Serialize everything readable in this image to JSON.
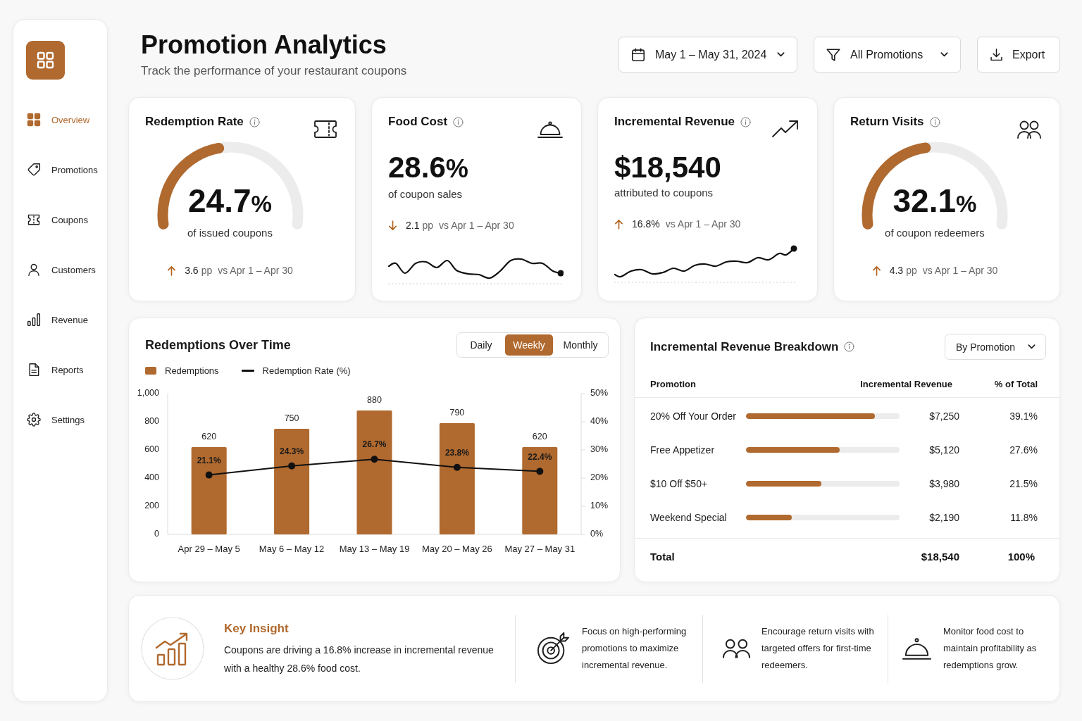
{
  "sidebar": {
    "items": [
      {
        "label": "Overview",
        "selected": true
      },
      {
        "label": "Promotions",
        "selected": false
      },
      {
        "label": "Coupons",
        "selected": false
      },
      {
        "label": "Customers",
        "selected": false
      },
      {
        "label": "Revenue",
        "selected": false
      },
      {
        "label": "Reports",
        "selected": false
      },
      {
        "label": "Settings",
        "selected": false
      }
    ]
  },
  "header": {
    "title": "Promotion Analytics",
    "subtitle": "Track the performance of your restaurant coupons"
  },
  "toolbar": {
    "date_range": "May 1 – May 31, 2024",
    "filter": "All Promotions",
    "export": "Export"
  },
  "kpis": [
    {
      "kind": "gauge",
      "title": "Redemption Rate",
      "value": "24.7",
      "unit": "%",
      "caption": "of issued coupons",
      "level": 0.45,
      "delta": {
        "rising": true,
        "value": "3.6",
        "unit": "pp",
        "comparison": "vs Apr 1 – Apr 30"
      }
    },
    {
      "kind": "sparkline",
      "title": "Food Cost",
      "value": "28.6",
      "unit": "%",
      "caption": "of coupon sales",
      "delta": {
        "rising": false,
        "value": "2.1",
        "unit": "pp",
        "comparison": "vs Apr 1 – Apr 30"
      }
    },
    {
      "kind": "sparkline",
      "title": "Incremental Revenue",
      "value": "$18,540",
      "caption": "attributed to coupons",
      "delta": {
        "rising": true,
        "value": "16.8%",
        "comparison": "vs Apr 1 – Apr 30"
      }
    },
    {
      "kind": "gauge",
      "title": "Return Visits",
      "value": "32.1",
      "unit": "%",
      "caption": "of coupon redeemers",
      "level": 0.46,
      "delta": {
        "rising": true,
        "value": "4.3",
        "unit": "pp",
        "comparison": "vs Apr 1 – Apr 30"
      }
    }
  ],
  "redemptions_chart": {
    "range_options": [
      {
        "label": "Daily",
        "selected": false
      },
      {
        "label": "Weekly",
        "selected": true
      },
      {
        "label": "Monthly",
        "selected": false
      }
    ],
    "chart_data": {
      "type": "bar",
      "title": "Redemptions Over Time",
      "legend": "top-left",
      "categories": [
        "Apr 29 – May 5",
        "May 6 – May 12",
        "May 13 – May 19",
        "May 20 – May 26",
        "May 27 – May 31"
      ],
      "series": [
        {
          "name": "Redemptions",
          "color": "#b0692e",
          "values": [
            620,
            750,
            880,
            790,
            620
          ],
          "value_labels": [
            "620",
            "750",
            "880",
            "790",
            "620"
          ]
        },
        {
          "name": "Redemption Rate (%)",
          "type": "line",
          "axis": "y2",
          "marker": true,
          "color": "#111111",
          "values": [
            21.1,
            24.3,
            26.7,
            23.8,
            22.4
          ],
          "value_labels": [
            "21.1%",
            "24.3%",
            "26.7%",
            "23.8%",
            "22.4%"
          ]
        }
      ],
      "ylim": [
        0,
        1000
      ],
      "yticks": [
        0,
        200,
        400,
        600,
        800,
        {
          "value": 1000,
          "label": "1,000"
        }
      ],
      "y2lim": [
        0,
        50
      ],
      "y2ticks": [
        {
          "value": 0,
          "label": "0%"
        },
        {
          "value": 10,
          "label": "10%"
        },
        {
          "value": 20,
          "label": "20%"
        },
        {
          "value": 30,
          "label": "30%"
        },
        {
          "value": 40,
          "label": "40%"
        },
        {
          "value": 50,
          "label": "50%"
        }
      ],
      "data_labels": true
    }
  },
  "revenue_breakdown": {
    "title": "Incremental Revenue Breakdown",
    "grouping": "By Promotion",
    "columns": [
      "Promotion",
      "Incremental Revenue",
      "% of Total"
    ],
    "rows": [
      {
        "promotion": "20% Off Your Order",
        "level": 0.84,
        "revenue": "$7,250",
        "share": "39.1%"
      },
      {
        "promotion": "Free Appetizer",
        "level": 0.61,
        "revenue": "$5,120",
        "share": "27.6%"
      },
      {
        "promotion": "$10 Off $50+",
        "level": 0.49,
        "revenue": "$3,980",
        "share": "21.5%"
      },
      {
        "promotion": "Weekend Special",
        "level": 0.3,
        "revenue": "$2,190",
        "share": "11.8%"
      }
    ],
    "total": {
      "label": "Total",
      "revenue": "$18,540",
      "share": "100%"
    }
  },
  "insight": {
    "title": "Key Insight",
    "text": "Coupons are driving a 16.8% increase in incremental revenue with a healthy 28.6% food cost.",
    "tips": [
      "Focus on high-performing promotions to maximize incremental revenue.",
      "Encourage return visits with targeted offers for first-time redeemers.",
      "Monitor food cost to maintain profitability as redemptions grow."
    ]
  }
}
